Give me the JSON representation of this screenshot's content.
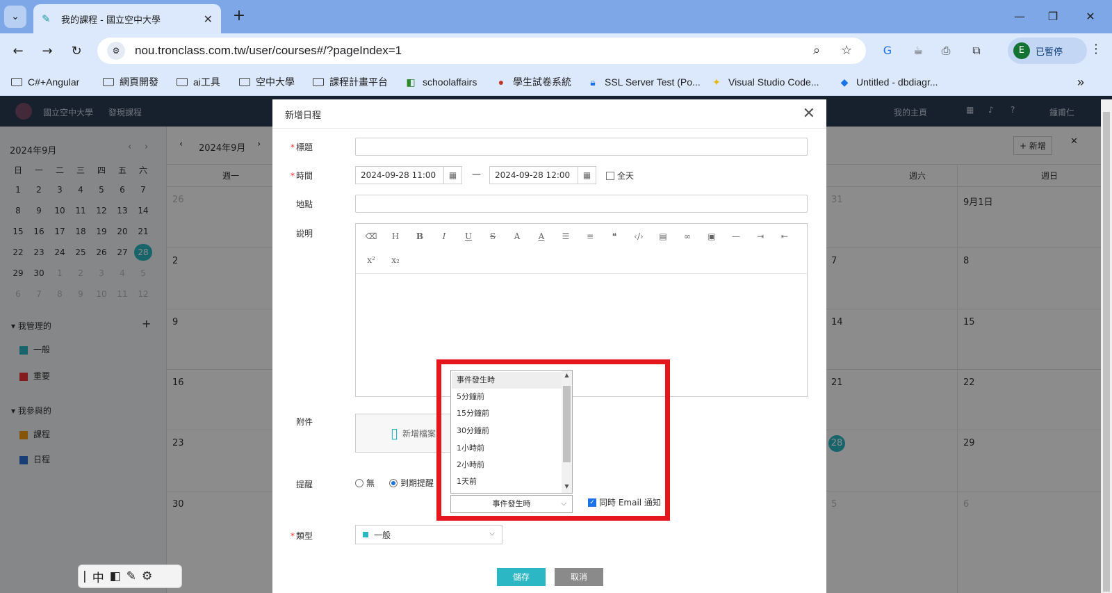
{
  "browser": {
    "tab_title": "我的課程 - 國立空中大學",
    "url": "nou.tronclass.com.tw/user/courses#/?pageIndex=1",
    "profile_initial": "E",
    "profile_status": "已暫停",
    "bookmarks": [
      "C#+Angular",
      "網頁開發",
      "ai工具",
      "空中大學",
      "課程計畫平台",
      "schoolaffairs",
      "學生試卷系統",
      "SSL Server Test (Po...",
      "Visual Studio Code...",
      "Untitled - dbdiagr..."
    ]
  },
  "site": {
    "brand": "國立空中大學",
    "nav_discover": "發現課程",
    "nav_home": "我的主頁",
    "user": "鍾甫仁",
    "add_button": "+ 新增"
  },
  "mini_calendar": {
    "title": "2024年9月",
    "weekdays": [
      "日",
      "一",
      "二",
      "三",
      "四",
      "五",
      "六"
    ],
    "weeks": [
      [
        "1",
        "2",
        "3",
        "4",
        "5",
        "6",
        "7"
      ],
      [
        "8",
        "9",
        "10",
        "11",
        "12",
        "13",
        "14"
      ],
      [
        "15",
        "16",
        "17",
        "18",
        "19",
        "20",
        "21"
      ],
      [
        "22",
        "23",
        "24",
        "25",
        "26",
        "27",
        "28"
      ],
      [
        "29",
        "30",
        "1",
        "2",
        "3",
        "4",
        "5"
      ],
      [
        "6",
        "7",
        "8",
        "9",
        "10",
        "11",
        "12"
      ]
    ],
    "managed_title": "我管理的",
    "managed": [
      "一般",
      "重要"
    ],
    "joined_title": "我參與的",
    "joined": [
      "課程",
      "日程"
    ]
  },
  "main_calendar": {
    "title": "2024年9月",
    "col_headers": [
      "週一",
      "週六",
      "週日"
    ],
    "cells": [
      "26",
      "2",
      "9",
      "16",
      "23",
      "30",
      "31",
      "7",
      "14",
      "21",
      "28",
      "5",
      "9月1日",
      "8",
      "15",
      "22",
      "29",
      "6"
    ]
  },
  "dialog": {
    "title": "新增日程",
    "label_title": "標題",
    "label_time": "時間",
    "start": "2024-09-28 11:00",
    "dash": "—",
    "end": "2024-09-28 12:00",
    "allday": "全天",
    "label_location": "地點",
    "label_desc": "說明",
    "label_attach": "附件",
    "attach_button": "新增檔案",
    "label_remind": "提醒",
    "remind_none": "無",
    "remind_due": "到期提醒",
    "label_type": "類型",
    "type_value": "一般",
    "save": "儲存",
    "cancel": "取消"
  },
  "reminder_dropdown": {
    "options": [
      "事件發生時",
      "5分鐘前",
      "15分鐘前",
      "30分鐘前",
      "1小時前",
      "2小時前",
      "1天前"
    ],
    "selected": "事件發生時",
    "email_notify": "同時 Email 通知"
  },
  "colors": {
    "accent": "#2bb7c4",
    "highlight": "#e5161e",
    "nav": "#2b3d54"
  },
  "ime": [
    "中"
  ]
}
